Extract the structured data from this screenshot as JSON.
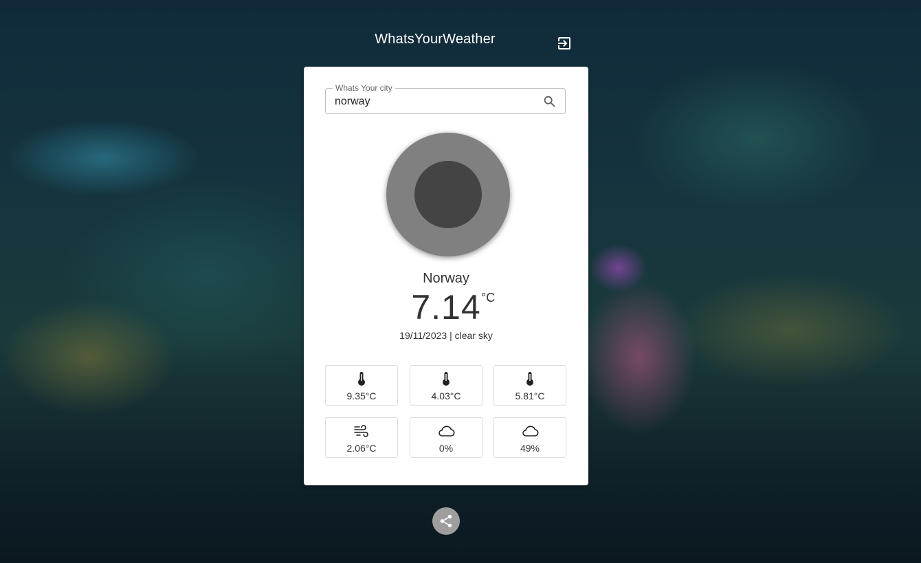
{
  "app": {
    "title": "WhatsYourWeather"
  },
  "header": {
    "logout_icon": "logout-icon"
  },
  "search": {
    "label": "Whats Your city",
    "value": "norway",
    "icon": "search-icon"
  },
  "weather": {
    "city": "Norway",
    "temperature": "7.14",
    "unit": "°C",
    "date_description": "19/11/2023 | clear sky"
  },
  "details": [
    {
      "icon": "thermometer-icon",
      "value": "9.35°C"
    },
    {
      "icon": "thermometer-icon",
      "value": "4.03°C"
    },
    {
      "icon": "thermometer-icon",
      "value": "5.81°C"
    },
    {
      "icon": "wind-icon",
      "value": "2.06°C"
    },
    {
      "icon": "cloud-icon",
      "value": "0%"
    },
    {
      "icon": "cloud-icon",
      "value": "49%"
    }
  ],
  "footer": {
    "share_icon": "share-icon"
  },
  "colors": {
    "card": "#ffffff",
    "text": "#333333",
    "share_button": "#9e9e9e",
    "weather_image_outer": "#808080",
    "weather_image_inner": "#444444"
  }
}
